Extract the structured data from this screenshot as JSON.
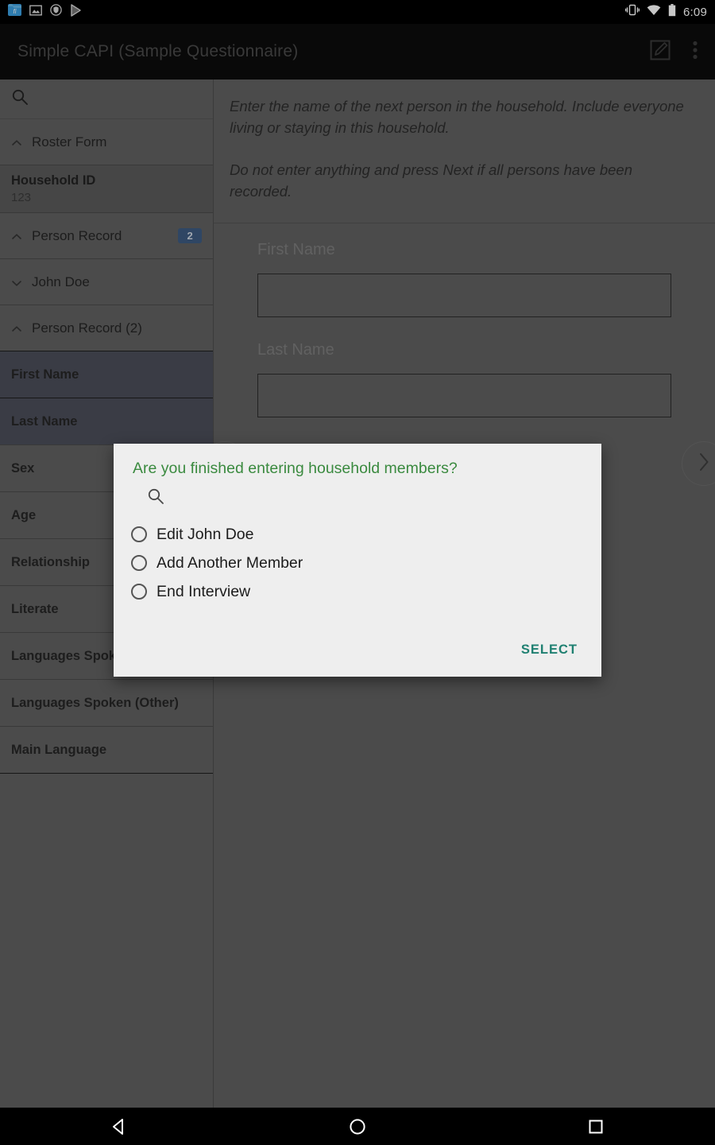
{
  "statusbar": {
    "left_icons": [
      "file-manager-icon",
      "gallery-icon",
      "shield-icon",
      "play-store-icon"
    ],
    "right_icons": [
      "vibrate-icon",
      "wifi-icon",
      "battery-icon"
    ],
    "time": "6:09"
  },
  "appbar": {
    "title": "Simple CAPI (Sample Questionnaire)",
    "actions": [
      "edit-icon",
      "overflow-menu-icon"
    ]
  },
  "sidebar": {
    "search_icon": "search-icon",
    "items": [
      {
        "type": "group",
        "label": "Roster Form",
        "caret": "up"
      },
      {
        "type": "kv",
        "label": "Household ID",
        "value": "123"
      },
      {
        "type": "group",
        "label": "Person Record",
        "caret": "up",
        "badge": "2"
      },
      {
        "type": "group",
        "label": "John Doe",
        "caret": "down"
      },
      {
        "type": "group",
        "label": "Person Record (2)",
        "caret": "up"
      },
      {
        "type": "field",
        "label": "First Name",
        "selected": true
      },
      {
        "type": "field",
        "label": "Last Name",
        "selected": true
      },
      {
        "type": "field",
        "label": "Sex"
      },
      {
        "type": "field",
        "label": "Age"
      },
      {
        "type": "field",
        "label": "Relationship"
      },
      {
        "type": "field",
        "label": "Literate"
      },
      {
        "type": "field",
        "label": "Languages Spoken"
      },
      {
        "type": "field",
        "label": "Languages Spoken (Other)"
      },
      {
        "type": "field",
        "label": "Main Language"
      }
    ]
  },
  "main": {
    "instruction_1": "Enter the name of the next person in the household. Include everyone living or staying in this household.",
    "instruction_2": "Do not enter anything and press Next if all persons have been recorded.",
    "fields": [
      {
        "label": "First Name",
        "value": ""
      },
      {
        "label": "Last Name",
        "value": ""
      }
    ],
    "prev_icon": "chevron-left-icon",
    "next_icon": "chevron-right-icon"
  },
  "dialog": {
    "title": "Are you finished entering household members?",
    "search_icon": "search-icon",
    "search_value": "",
    "options": [
      {
        "label": "Edit John Doe",
        "checked": false
      },
      {
        "label": "Add Another Member",
        "checked": false
      },
      {
        "label": "End Interview",
        "checked": false
      }
    ],
    "select_label": "SELECT"
  },
  "navbar": {
    "back": "back-triangle-icon",
    "home": "home-circle-icon",
    "recents": "recents-square-icon"
  },
  "colors": {
    "dialog_title_green": "#3a8a3f",
    "select_teal": "#1f8071",
    "badge_blue": "#3d5a80",
    "selected_row": "#4b4d59"
  }
}
